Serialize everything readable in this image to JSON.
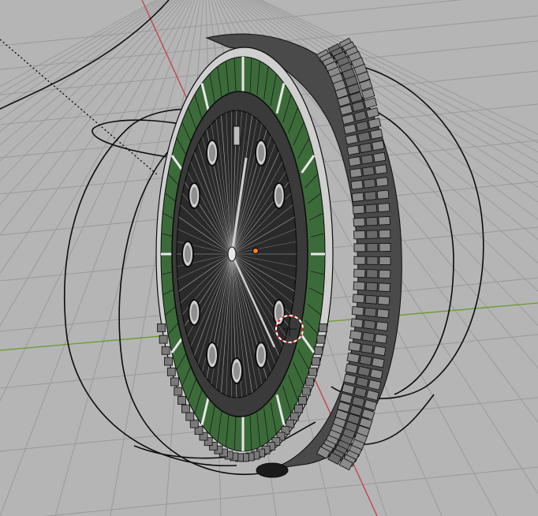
{
  "viewport": {
    "kind": "3D viewport",
    "view": "perspective",
    "shading": "solid",
    "overlays": [
      "floor-grid",
      "x-axis-line",
      "y-axis-line",
      "wireframe",
      "3d-cursor",
      "object-origin"
    ]
  },
  "scene": {
    "object": "watch-model",
    "parts": [
      "bezel",
      "fluted-bezel-ring",
      "dial",
      "hour-markers",
      "hour-hand",
      "minute-hand",
      "center-cap",
      "crown"
    ],
    "curves": [
      "wire-loop-left",
      "wire-loop-right",
      "wire-loop-top",
      "wire-loop-bottom"
    ]
  },
  "colors": {
    "viewport_background": "#3d3d3d",
    "floor": "#b5b5b5",
    "grid_line": "#9a9a9a",
    "x_axis": "#c0404a",
    "y_axis": "#6a9a2a",
    "wire": "#0c0c0c",
    "bezel_green": "#3c6b3a",
    "metal_light": "#cfcfcf",
    "metal_dark": "#4a4a4a",
    "dial": "#2a2a2a",
    "cursor_ring": "#d02020",
    "origin": "#ff7f1a"
  }
}
